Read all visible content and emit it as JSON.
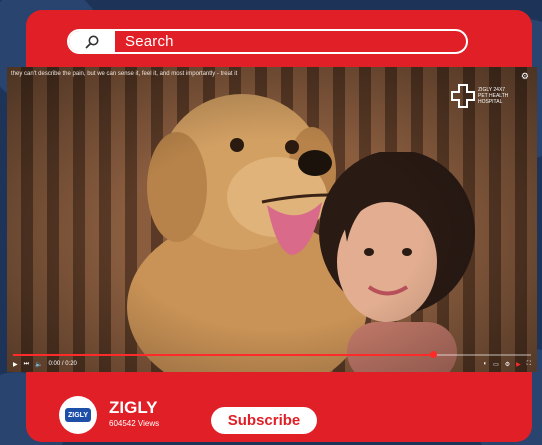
{
  "search": {
    "text": "Search"
  },
  "video": {
    "caption": "they can't describe the pain, but we can sense it, feel it, and most importantly - treat it",
    "brand": {
      "line1": "ZIGLY 24X7",
      "line2": "PET HEALTH",
      "line3": "HOSPITAL"
    },
    "progress": 0.81,
    "time": "0:00 / 0:20"
  },
  "channel": {
    "logo_text": "ZIGLY",
    "name": "ZIGLY",
    "views": "604542 Views",
    "subscribe_label": "Subscribe"
  },
  "colors": {
    "card": "#e01f26",
    "background": "#1e3358",
    "accent": "#ff2a2a"
  }
}
